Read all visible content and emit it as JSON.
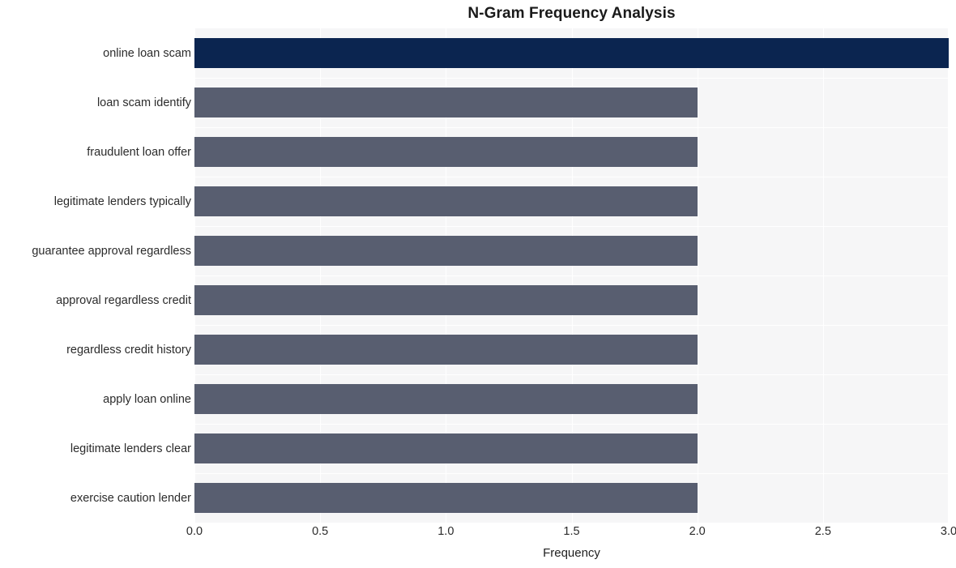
{
  "chart_data": {
    "type": "bar",
    "orientation": "horizontal",
    "title": "N-Gram Frequency Analysis",
    "xlabel": "Frequency",
    "ylabel": "",
    "xlim": [
      0.0,
      3.0
    ],
    "xticks": [
      "0.0",
      "0.5",
      "1.0",
      "1.5",
      "2.0",
      "2.5",
      "3.0"
    ],
    "xtick_values": [
      0.0,
      0.5,
      1.0,
      1.5,
      2.0,
      2.5,
      3.0
    ],
    "grid": true,
    "grid_color": "#ffffff",
    "plot_background": "#f6f6f7",
    "legend": "none",
    "categories": [
      "online loan scam",
      "loan scam identify",
      "fraudulent loan offer",
      "legitimate lenders typically",
      "guarantee approval regardless",
      "approval regardless credit",
      "regardless credit history",
      "apply loan online",
      "legitimate lenders clear",
      "exercise caution lender"
    ],
    "values": [
      3,
      2,
      2,
      2,
      2,
      2,
      2,
      2,
      2,
      2
    ],
    "bar_colors": [
      "#0b2550",
      "#585e70",
      "#585e70",
      "#585e70",
      "#585e70",
      "#585e70",
      "#585e70",
      "#585e70",
      "#585e70",
      "#585e70"
    ],
    "highlight_color": "#0b2550",
    "default_bar_color": "#585e70"
  }
}
